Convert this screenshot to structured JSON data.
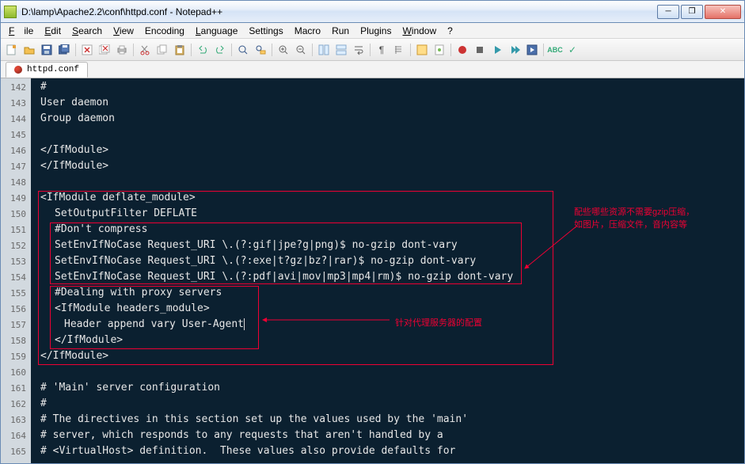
{
  "window": {
    "title": "D:\\lamp\\Apache2.2\\conf\\httpd.conf - Notepad++"
  },
  "menu": {
    "file": "File",
    "edit": "Edit",
    "search": "Search",
    "view": "View",
    "encoding": "Encoding",
    "language": "Language",
    "settings": "Settings",
    "macro": "Macro",
    "run": "Run",
    "plugins": "Plugins",
    "window": "Window",
    "help": "?"
  },
  "tab": {
    "name": "httpd.conf"
  },
  "gutter_start": 142,
  "code_lines": [
    "#",
    "User daemon",
    "Group daemon",
    "",
    "</IfModule>",
    "</IfModule>",
    "",
    "<IfModule deflate_module>",
    "SetOutputFilter DEFLATE",
    "#Don't compress",
    "SetEnvIfNoCase Request_URI \\.(?:gif|jpe?g|png)$ no-gzip dont-vary",
    "SetEnvIfNoCase Request_URI \\.(?:exe|t?gz|bz?|rar)$ no-gzip dont-vary",
    "SetEnvIfNoCase Request_URI \\.(?:pdf|avi|mov|mp3|mp4|rm)$ no-gzip dont-vary",
    "#Dealing with proxy servers",
    "<IfModule headers_module>",
    "Header append vary User-Agent",
    "</IfModule>",
    "</IfModule>",
    "",
    "# 'Main' server configuration",
    "#",
    "# The directives in this section set up the values used by the 'main'",
    "# server, which responds to any requests that aren't handled by a",
    "# <VirtualHost> definition.  These values also provide defaults for"
  ],
  "indent": [
    0,
    0,
    0,
    0,
    0,
    0,
    0,
    0,
    1,
    1,
    1,
    1,
    1,
    1,
    1,
    2,
    1,
    0,
    0,
    0,
    0,
    0,
    0,
    0
  ],
  "annotations": {
    "right_note": "配些哪些资源不需要gzip压缩，\n如图片，压缩文件，音内容等",
    "proxy_note": "针对代理服务器的配置"
  }
}
